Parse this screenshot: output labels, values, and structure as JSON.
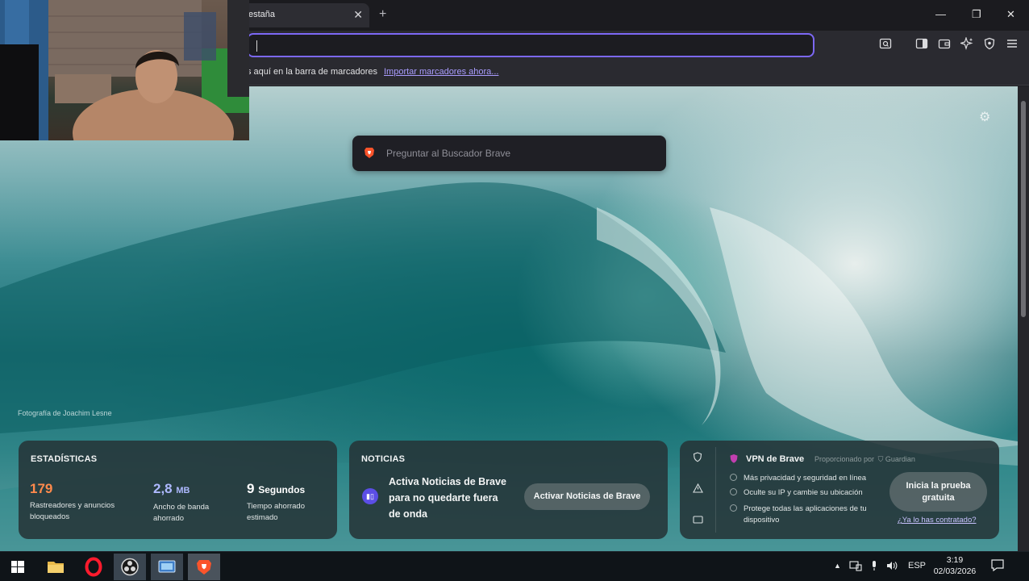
{
  "browser": {
    "tab": {
      "title": "estaña",
      "close_glyph": "✕"
    },
    "new_tab_glyph": "+",
    "window_controls": {
      "minimize": "—",
      "maximize": "❐",
      "close": "✕"
    },
    "address_bar": {
      "value": ""
    },
    "toolbar_icons": [
      "reader-mode-icon",
      "sidebar-icon",
      "wallet-icon",
      "leo-ai-icon",
      "brave-shields-icon",
      "menu-icon"
    ],
    "bookmarks_bar": {
      "hint": "s aquí en la barra de marcadores",
      "import_link": "Importar marcadores ahora..."
    },
    "accent_color": "#7c68f5"
  },
  "new_tab_page": {
    "search_placeholder": "Preguntar al Buscador Brave",
    "photo_credit": "Fotografía de Joachim Lesne",
    "stats": {
      "title": "ESTADÍSTICAS",
      "trackers": {
        "value": "179",
        "label_line1": "Rastreadores y anuncios",
        "label_line2": "bloqueados",
        "color": "#ff8a4c"
      },
      "bandwidth": {
        "value": "2,8",
        "unit": "MB",
        "label_line1": "Ancho de banda",
        "label_line2": "ahorrado",
        "color": "#aeb9ff"
      },
      "time": {
        "value": "9",
        "unit": "Segundos",
        "label_line1": "Tiempo ahorrado",
        "label_line2": "estimado",
        "color": "#ffffff"
      }
    },
    "news": {
      "title": "NOTICIAS",
      "message": "Activa Noticias de Brave para no quedarte fuera de onda",
      "button": "Activar Noticias de Brave"
    },
    "vpn": {
      "title": "VPN de Brave",
      "provided_by": "Proporcionado por",
      "provider": "Guardian",
      "features": [
        "Más privacidad y seguridad en línea",
        "Oculte su IP y cambie su ubicación",
        "Protege todas las aplicaciones de tu",
        "dispositivo"
      ],
      "cta_line1": "Inicia la prueba",
      "cta_line2": "gratuita",
      "already_link": "¿Ya lo has contratado?",
      "rail_icons": [
        "shield-icon",
        "warning-icon",
        "ticket-icon"
      ]
    }
  },
  "taskbar": {
    "apps": [
      "windows-start-icon",
      "file-explorer-icon",
      "opera-icon",
      "obs-studio-icon",
      "screen-app-icon",
      "brave-browser-icon"
    ],
    "tray": {
      "chevron": "▲",
      "language": "ESP"
    },
    "clock": {
      "time": "3:19",
      "date": "02/03/2026"
    }
  }
}
